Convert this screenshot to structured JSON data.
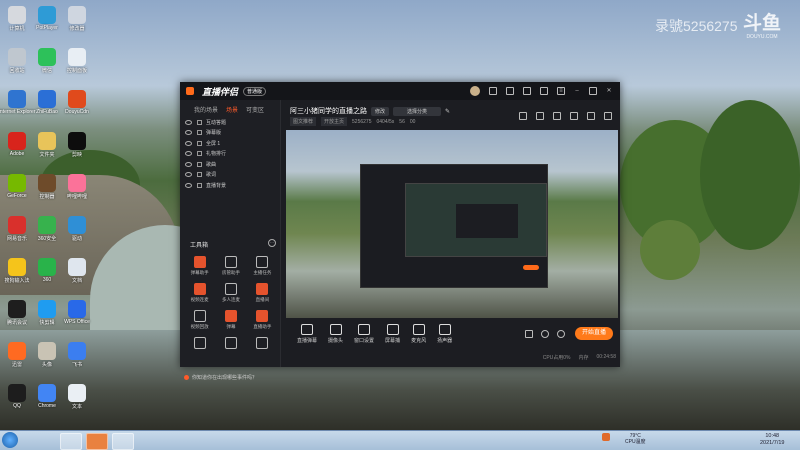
{
  "desktop": {
    "watermark": "录號5256275",
    "logo_text": "斗鱼",
    "logo_sub": "DOUYU.COM",
    "icons": [
      {
        "label": "计算机",
        "color": "#d6d9de"
      },
      {
        "label": "PotPlayer",
        "color": "#2e9bd6"
      },
      {
        "label": "修改器",
        "color": "#cfd6e0"
      },
      {
        "label": "回收站",
        "color": "#bfc7cf"
      },
      {
        "label": "微信",
        "color": "#2dc15a"
      },
      {
        "label": "控制面板",
        "color": "#e8eef4"
      },
      {
        "label": "Internet Explorer",
        "color": "#2f74d0"
      },
      {
        "label": "ZhiFuBao",
        "color": "#2b6fd6"
      },
      {
        "label": "DouyuCdn",
        "color": "#e04a1c"
      },
      {
        "label": "Adobe",
        "color": "#d8241c"
      },
      {
        "label": "文件夹",
        "color": "#e8c45a"
      },
      {
        "label": "剪映",
        "color": "#0d0d0d"
      },
      {
        "label": "GeForce",
        "color": "#76b900"
      },
      {
        "label": "控制器",
        "color": "#6e4b2a"
      },
      {
        "label": "哔哩哔哩",
        "color": "#fb7299"
      },
      {
        "label": "网易音乐",
        "color": "#d9302c"
      },
      {
        "label": "360安全",
        "color": "#37b24d"
      },
      {
        "label": "驱动",
        "color": "#2f8fd6"
      },
      {
        "label": "搜狗输入法",
        "color": "#f5c41b"
      },
      {
        "label": "360",
        "color": "#29b34a"
      },
      {
        "label": "文档",
        "color": "#dfe6ee"
      },
      {
        "label": "腾讯会议",
        "color": "#1e1e1e"
      },
      {
        "label": "快剪辑",
        "color": "#1f9cf0"
      },
      {
        "label": "WPS Office",
        "color": "#2969e8"
      },
      {
        "label": "迅雷",
        "color": "#ff6a21"
      },
      {
        "label": "头像",
        "color": "#c9c3b4"
      },
      {
        "label": "飞书",
        "color": "#3b7ef0"
      },
      {
        "label": "QQ",
        "color": "#1d1d1d"
      },
      {
        "label": "Chrome",
        "color": "#4285f4"
      },
      {
        "label": "文本",
        "color": "#eaeff4"
      }
    ]
  },
  "app": {
    "brand": "直播伴侣",
    "edition": "普通版",
    "left_tabs": [
      "我的场景",
      "场景",
      "可变区"
    ],
    "scenes": [
      "互动答题",
      "弹幕版",
      "全屏 1",
      "礼物排行",
      "歌曲",
      "歌词",
      "直播背景"
    ],
    "tools_title": "工具箱",
    "tools": [
      {
        "label": "弹幕助手",
        "red": true
      },
      {
        "label": "房管助手",
        "red": false
      },
      {
        "label": "主播任务",
        "red": false
      },
      {
        "label": "视频连麦",
        "red": true
      },
      {
        "label": "多人连麦",
        "red": false
      },
      {
        "label": "直播间",
        "red": true
      },
      {
        "label": "视频回放",
        "red": false
      },
      {
        "label": "弹幕",
        "red": true
      },
      {
        "label": "直播助手",
        "red": true
      },
      {
        "label": "",
        "red": false
      },
      {
        "label": "",
        "red": false
      },
      {
        "label": "",
        "red": false
      }
    ],
    "notice": "你知道你在出现哪些事件吗？",
    "room_title": "阿三小猪同学的直播之路",
    "edit_pill": "修改",
    "category_pill": "选择分类",
    "sub_items": [
      "图文推荐",
      "开放主页",
      "5256275",
      "0404/5s",
      "56",
      "00"
    ],
    "bottom_items": [
      "直播弹幕",
      "摄像头",
      "窗口设置",
      "屏幕捕",
      "麦克风",
      "扬声器"
    ],
    "go_live": "开始直播",
    "status_items": [
      "CPU占用0%",
      "内存",
      "00:24:58"
    ]
  },
  "taskbar": {
    "tray_text": "79°C\nCPU温度",
    "time": "10:48",
    "date": "2021/7/19"
  }
}
